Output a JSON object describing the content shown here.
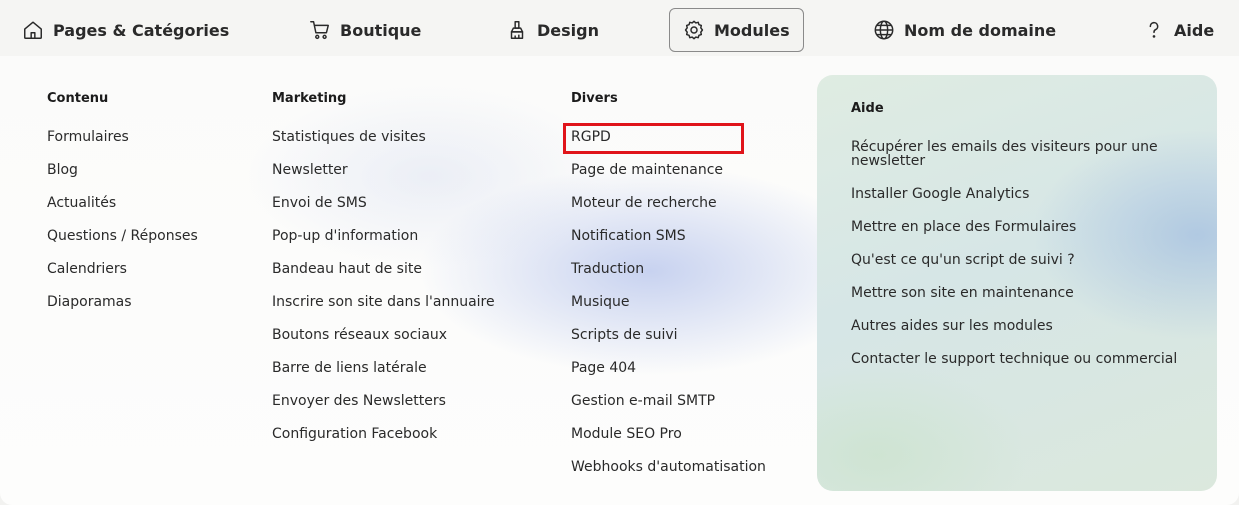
{
  "nav": {
    "items": [
      {
        "label": "Pages & Catégories",
        "icon": "home-icon"
      },
      {
        "label": "Boutique",
        "icon": "cart-icon"
      },
      {
        "label": "Design",
        "icon": "paint-brush-icon"
      },
      {
        "label": "Modules",
        "icon": "gear-icon",
        "active": true
      },
      {
        "label": "Nom de domaine",
        "icon": "globe-icon"
      },
      {
        "label": "Aide",
        "icon": "question-icon"
      }
    ]
  },
  "columns": {
    "contenu": {
      "title": "Contenu",
      "items": [
        "Formulaires",
        "Blog",
        "Actualités",
        "Questions / Réponses",
        "Calendriers",
        "Diaporamas"
      ]
    },
    "marketing": {
      "title": "Marketing",
      "items": [
        "Statistiques de visites",
        "Newsletter",
        "Envoi de SMS",
        "Pop-up d'information",
        "Bandeau haut de site",
        "Inscrire son site dans l'annuaire",
        "Boutons réseaux sociaux",
        "Barre de liens latérale",
        "Envoyer des Newsletters",
        "Configuration Facebook"
      ]
    },
    "divers": {
      "title": "Divers",
      "items": [
        "RGPD",
        "Page de maintenance",
        "Moteur de recherche",
        "Notification SMS",
        "Traduction",
        "Musique",
        "Scripts de suivi",
        "Page 404",
        "Gestion e-mail SMTP",
        "Module SEO Pro",
        "Webhooks d'automatisation"
      ]
    }
  },
  "help": {
    "title": "Aide",
    "links": [
      "Récupérer les emails des visiteurs pour une newsletter",
      "Installer Google Analytics",
      "Mettre en place des Formulaires",
      "Qu'est ce qu'un script de suivi ?",
      "Mettre son site en maintenance",
      "Autres aides sur les modules",
      "Contacter le support technique ou commercial"
    ]
  },
  "colors": {
    "highlight": "#e0141a",
    "text": "#2a2a2a"
  }
}
